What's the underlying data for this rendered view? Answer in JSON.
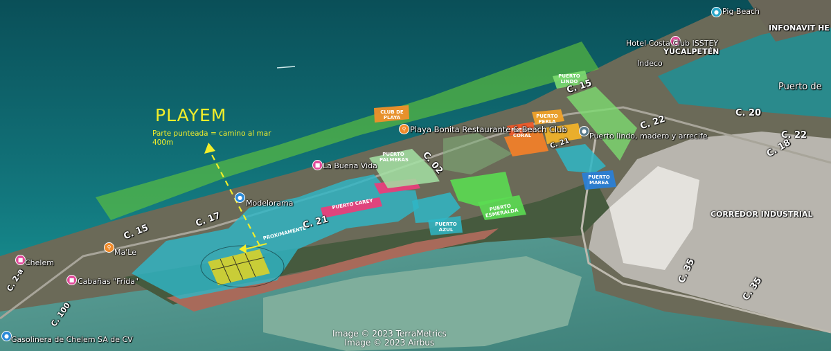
{
  "overlay": {
    "title": "PLAYEM",
    "note_line1": "Parte punteada = camino al mar",
    "note_line2": "400m"
  },
  "parcels": {
    "club_playa": "CLUB DE PLAYA",
    "puerto_palmeras": "PUERTO PALMERAS",
    "puerto_carey": "PUERTO CAREY",
    "puerto_esmeralda": "PUERTO ESMERALDA",
    "puerto_marea": "PUERTO MAREA",
    "proximamente": "PROXIMAMENTE",
    "puerto_perla": "PUERTO PERLA",
    "puerto_coral": "PUERTO CORAL",
    "puerto_lindo": "PUERTO LINDO",
    "puerto_azul": "PUERTO AZUL"
  },
  "roads": {
    "c15_left": "C. 15",
    "c17": "C. 17",
    "c21": "C. 21",
    "c02": "C. 02",
    "c15_right": "C. 15",
    "c21_right": "C. 21",
    "c22": "C. 22",
    "c20": "C. 20",
    "c18": "C. 18",
    "c22_far": "C. 22",
    "c35_a": "C. 35",
    "c35_b": "C. 35",
    "c2a": "C. 2-a",
    "c100": "C. 100"
  },
  "places": {
    "pig_beach": "Pig Beach",
    "infonavit": "INFONAVIT HE",
    "hotel_costa": "Hotel Costa Club ISSTEY",
    "yucalpeten": "YUCALPETÉN",
    "indeco": "Indeco",
    "puerto": "Puerto de",
    "playa_bonita": "Playa Bonita Restaurante & Beach Club",
    "puerto_lindo_poi": "Puerto lindo, madero y arrecife",
    "la_buena_vida": "La Buena Vida",
    "modelorama": "Modelorama",
    "corredor": "CORREDOR INDUSTRIAL",
    "chelem": "Chelem",
    "male": "Ma'Le",
    "cabanas": "Cabañas \"Frida\"",
    "gasolinera": "Gasolinera de Chelem SA de CV"
  },
  "credits": {
    "line1": "Image © 2023 TerraMetrics",
    "line2": "Image © 2023 Airbus"
  },
  "colors": {
    "sea": "#0f6a72",
    "land": "#6e6e5a",
    "green_overlay": "#63c63a",
    "cyan_parcels": "#2fb6c6",
    "yellow": "#f2ee2a",
    "pink": "#e83e7a",
    "orange": "#f07f2a",
    "light_green": "#6de06d",
    "salt_flats": "#d8d5cf"
  }
}
